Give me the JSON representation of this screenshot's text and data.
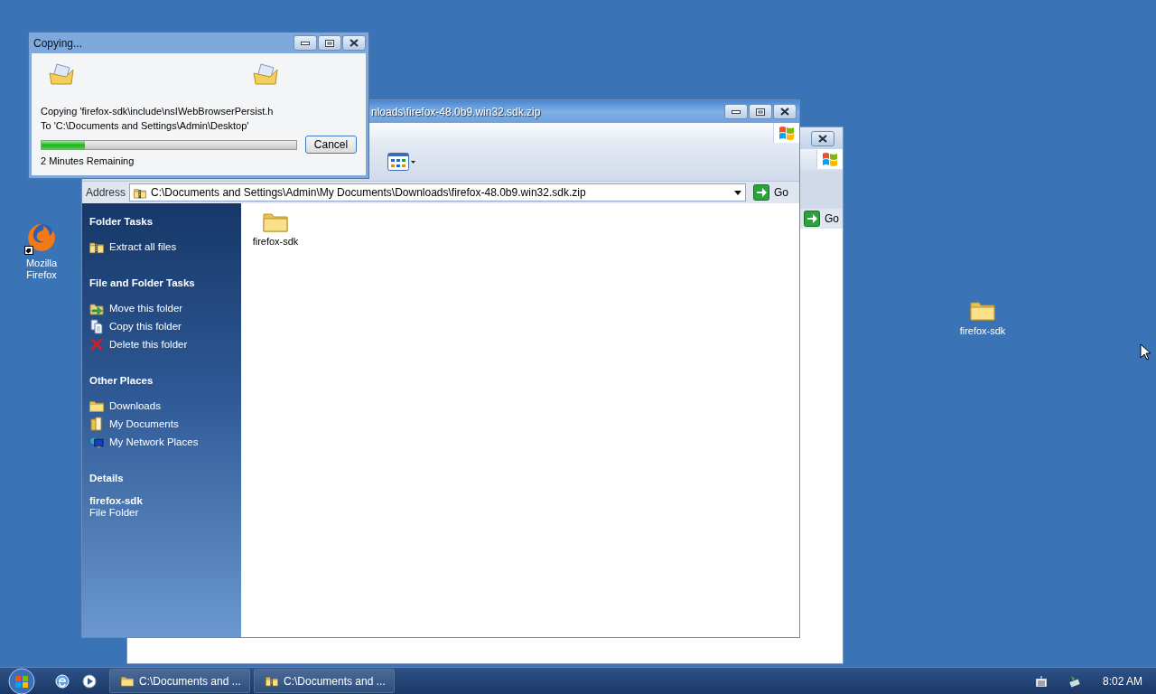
{
  "desktop_icons": [
    {
      "label": "Mozilla Firefox",
      "kind": "browser",
      "shortcut": true
    },
    {
      "label": "firefox-sdk",
      "kind": "folder",
      "shortcut": false
    }
  ],
  "back_window": {
    "go_button": "Go"
  },
  "explorer": {
    "title": "nloads\\firefox-48.0b9.win32.sdk.zip",
    "address_label": "Address",
    "address": "C:\\Documents and Settings\\Admin\\My Documents\\Downloads\\firefox-48.0b9.win32.sdk.zip",
    "go_button": "Go",
    "task_groups": [
      {
        "title": "Folder Tasks",
        "items": [
          {
            "label": "Extract all files",
            "kind": "extract"
          }
        ]
      },
      {
        "title": "File and Folder Tasks",
        "items": [
          {
            "label": "Move this folder",
            "kind": "move"
          },
          {
            "label": "Copy this folder",
            "kind": "copy"
          },
          {
            "label": "Delete this folder",
            "kind": "delete"
          }
        ]
      },
      {
        "title": "Other Places",
        "items": [
          {
            "label": "Downloads",
            "kind": "folder"
          },
          {
            "label": "My Documents",
            "kind": "documents"
          },
          {
            "label": "My Network Places",
            "kind": "network"
          }
        ]
      }
    ],
    "details": {
      "title": "Details",
      "name": "firefox-sdk",
      "type": "File Folder"
    },
    "files": [
      {
        "name": "firefox-sdk",
        "kind": "folder"
      }
    ]
  },
  "copy_dialog": {
    "title": "Copying...",
    "file_line": "Copying 'firefox-sdk\\include\\nsIWebBrowserPersist.h",
    "dest_line": "To 'C:\\Documents and Settings\\Admin\\Desktop'",
    "level": 0.17,
    "remaining": "2 Minutes Remaining",
    "cancel_button": "Cancel"
  },
  "taskbar": {
    "tasks": [
      {
        "label": "C:\\Documents and ...",
        "kind": "folder"
      },
      {
        "label": "C:\\Documents and ...",
        "kind": "zip"
      }
    ],
    "clock": "8:02 AM"
  }
}
